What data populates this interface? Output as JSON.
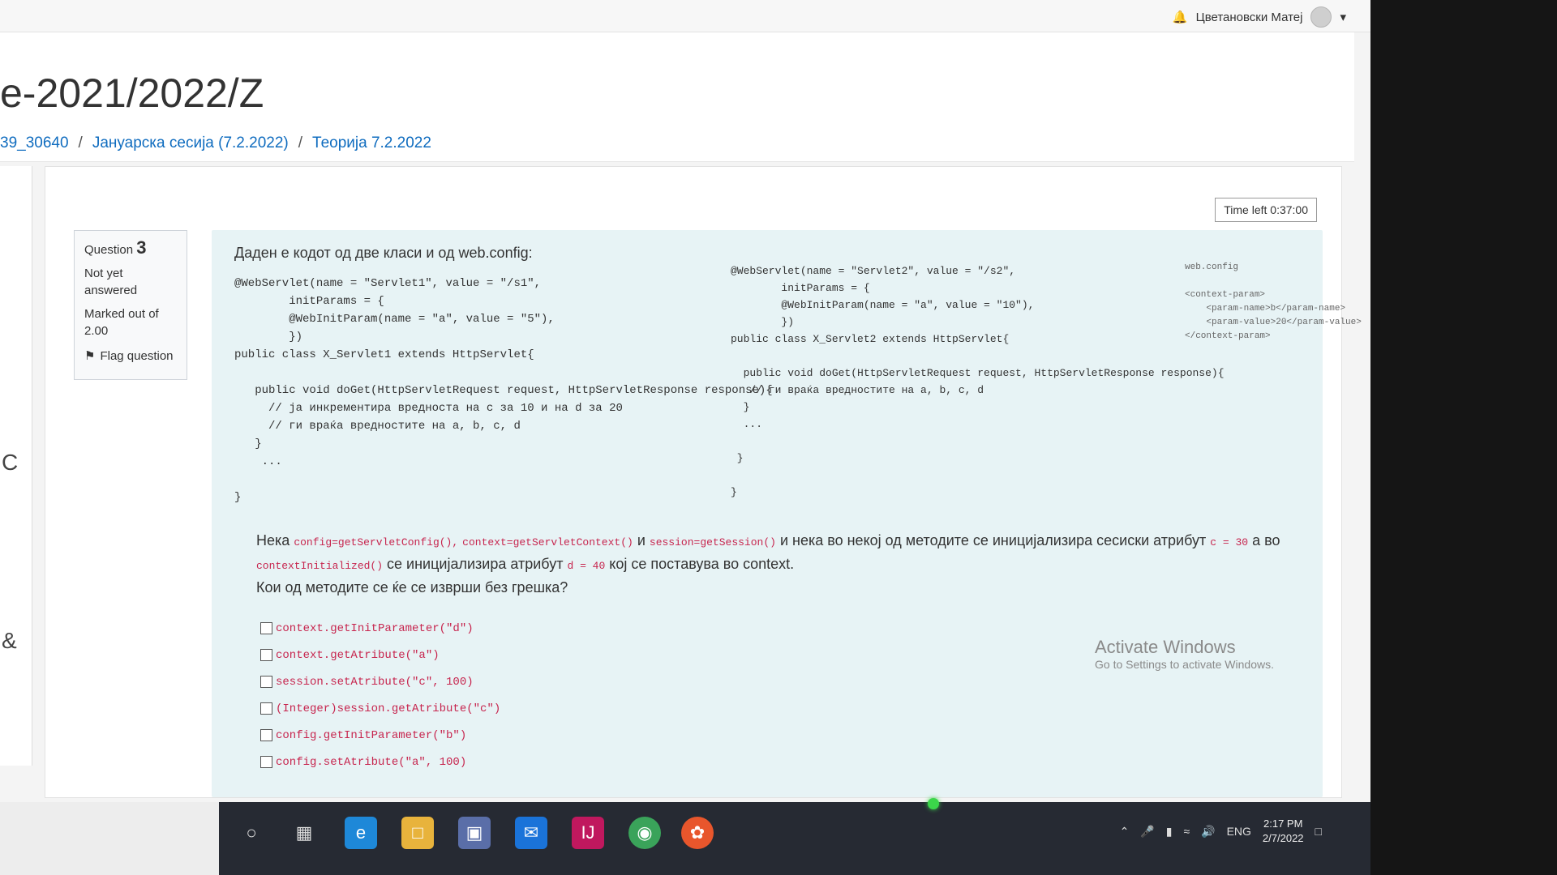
{
  "topbar": {
    "user_name": "Цветановски Матеј",
    "bell_icon": "bell-icon",
    "dropdown_icon": "chevron-down-icon"
  },
  "header": {
    "course_title": "e-2021/2022/Z",
    "breadcrumb": [
      "39_30640",
      "Јануарска сесија (7.2.2022)",
      "Теорија 7.2.2022"
    ]
  },
  "left_nav": {
    "glyph_1": "C",
    "glyph_2": "&"
  },
  "quiz": {
    "timer": "Time left 0:37:00",
    "question_label": "Question",
    "question_number": "3",
    "status": "Not yet answered",
    "marks": "Marked out of 2.00",
    "flag_label": "Flag question",
    "intro": "Даден е кодот од две класи и од web.config:",
    "code_servlet1": "@WebServlet(name = \"Servlet1\", value = \"/s1\",\n        initParams = {\n        @WebInitParam(name = \"a\", value = \"5\"),\n        })\npublic class X_Servlet1 extends HttpServlet{\n\n   public void doGet(HttpServletRequest request, HttpServletResponse response){\n     // ја инкрементира вредноста на c за 10 и на d за 20\n     // ги враќа вредностите на a, b, c, d\n   }\n    ...\n\n}",
    "code_servlet2": "@WebServlet(name = \"Servlet2\", value = \"/s2\",\n        initParams = {\n        @WebInitParam(name = \"a\", value = \"10\"),\n        })\npublic class X_Servlet2 extends HttpServlet{\n\n  public void doGet(HttpServletRequest request, HttpServletResponse response){\n   // ги враќа вредностите на a, b, c, d\n  }\n  ...\n\n }\n\n}",
    "code_webconfig": "web.config\n\n<context-param>\n    <param-name>b</param-name>\n    <param-value>20</param-value>\n</context-param>",
    "prompt": {
      "p1": "Нека",
      "config_code": "config=getServletConfig(),",
      "context_code": "context=getServletContext()",
      "and": "и",
      "session_code": "session=getSession()",
      "p2": "и нека во некој од методите се иницијализира сесиски атрибут",
      "c_code": "c = 30",
      "p3": "а во",
      "ctx_init_code": "contextInitialized()",
      "p4": "се иницијализира атрибут",
      "d_code": "d = 40",
      "p5": "кој се поставува во context.",
      "question": "Кои од методите се ќе се изврши без грешка?"
    },
    "options": [
      "context.getInitParameter(\"d\")",
      "context.getAtribute(\"a\")",
      "session.setAtribute(\"c\", 100)",
      "(Integer)session.getAtribute(\"c\")",
      "config.getInitParameter(\"b\")",
      "config.setAtribute(\"a\", 100)"
    ]
  },
  "watermark": {
    "title": "Activate Windows",
    "subtitle": "Go to Settings to activate Windows."
  },
  "taskbar": {
    "language": "ENG",
    "time": "2:17 PM",
    "date": "2/7/2022",
    "apps": [
      "search-icon",
      "task-view-icon",
      "edge-icon",
      "file-explorer-icon",
      "store-icon",
      "mail-icon",
      "intellij-icon",
      "chrome-icon",
      "firefox-icon"
    ]
  }
}
